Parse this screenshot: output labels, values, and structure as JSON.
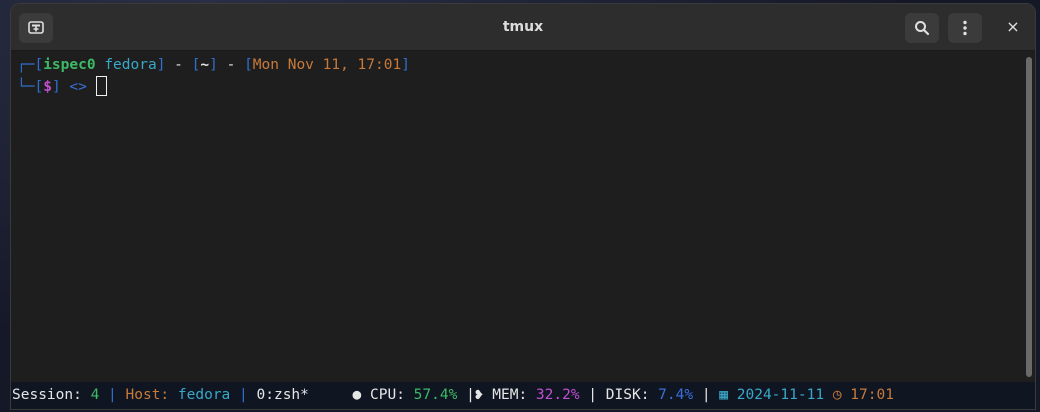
{
  "window": {
    "title": "tmux"
  },
  "icons": {
    "new_tab": "new-tab-icon",
    "search": "search-icon",
    "menu": "kebab-menu-icon",
    "close": "close-icon"
  },
  "prompt": {
    "corner_top": "┌─",
    "corner_bottom": "└─",
    "open": "[",
    "close": "]",
    "user": "ispec0",
    "host": "fedora",
    "sep": " - ",
    "cwd": "~",
    "datetime": "Mon Nov 11, 17:01",
    "symbol": "$",
    "arrows": "<>"
  },
  "status": {
    "session_label": "Session: ",
    "session_value": "4",
    "divider": " | ",
    "host_label": "Host: ",
    "host_value": "fedora",
    "window": "0:zsh*",
    "cpu_icon": "●",
    "cpu_label": " CPU: ",
    "cpu_value": "57.4%",
    "mem_icon": "❥",
    "mem_label": " MEM: ",
    "mem_value": "32.2%",
    "disk_label": "DISK: ",
    "disk_value": "7.4%",
    "cal_icon": "▦",
    "date": "2024-11-11",
    "clock_icon": "◷",
    "time": "17:01"
  },
  "colors": {
    "bracket": "#2f6fd0",
    "user": "#3dba66",
    "host": "#39a8c8",
    "datetime": "#c77a3a",
    "mem": "#c050d0"
  }
}
